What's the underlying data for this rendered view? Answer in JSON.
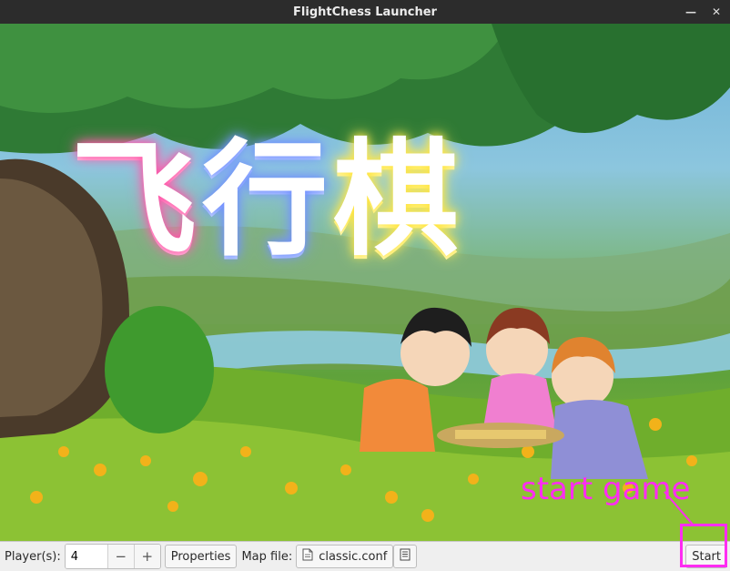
{
  "window": {
    "title": "FlightChess Launcher"
  },
  "logo": {
    "char1": "飞",
    "char2": "行",
    "char3": "棋"
  },
  "annotation": {
    "text": "start game",
    "color": "#ff2cf2"
  },
  "toolbar": {
    "players_label": "Player(s):",
    "players_value": "4",
    "decrement": "−",
    "increment": "+",
    "properties_label": "Properties",
    "mapfile_label": "Map file:",
    "mapfile_value": "classic.conf",
    "start_label": "Start"
  },
  "icons": {
    "minimize": "minimize-icon",
    "close": "close-icon",
    "file": "file-icon",
    "browse": "open-file-icon"
  }
}
